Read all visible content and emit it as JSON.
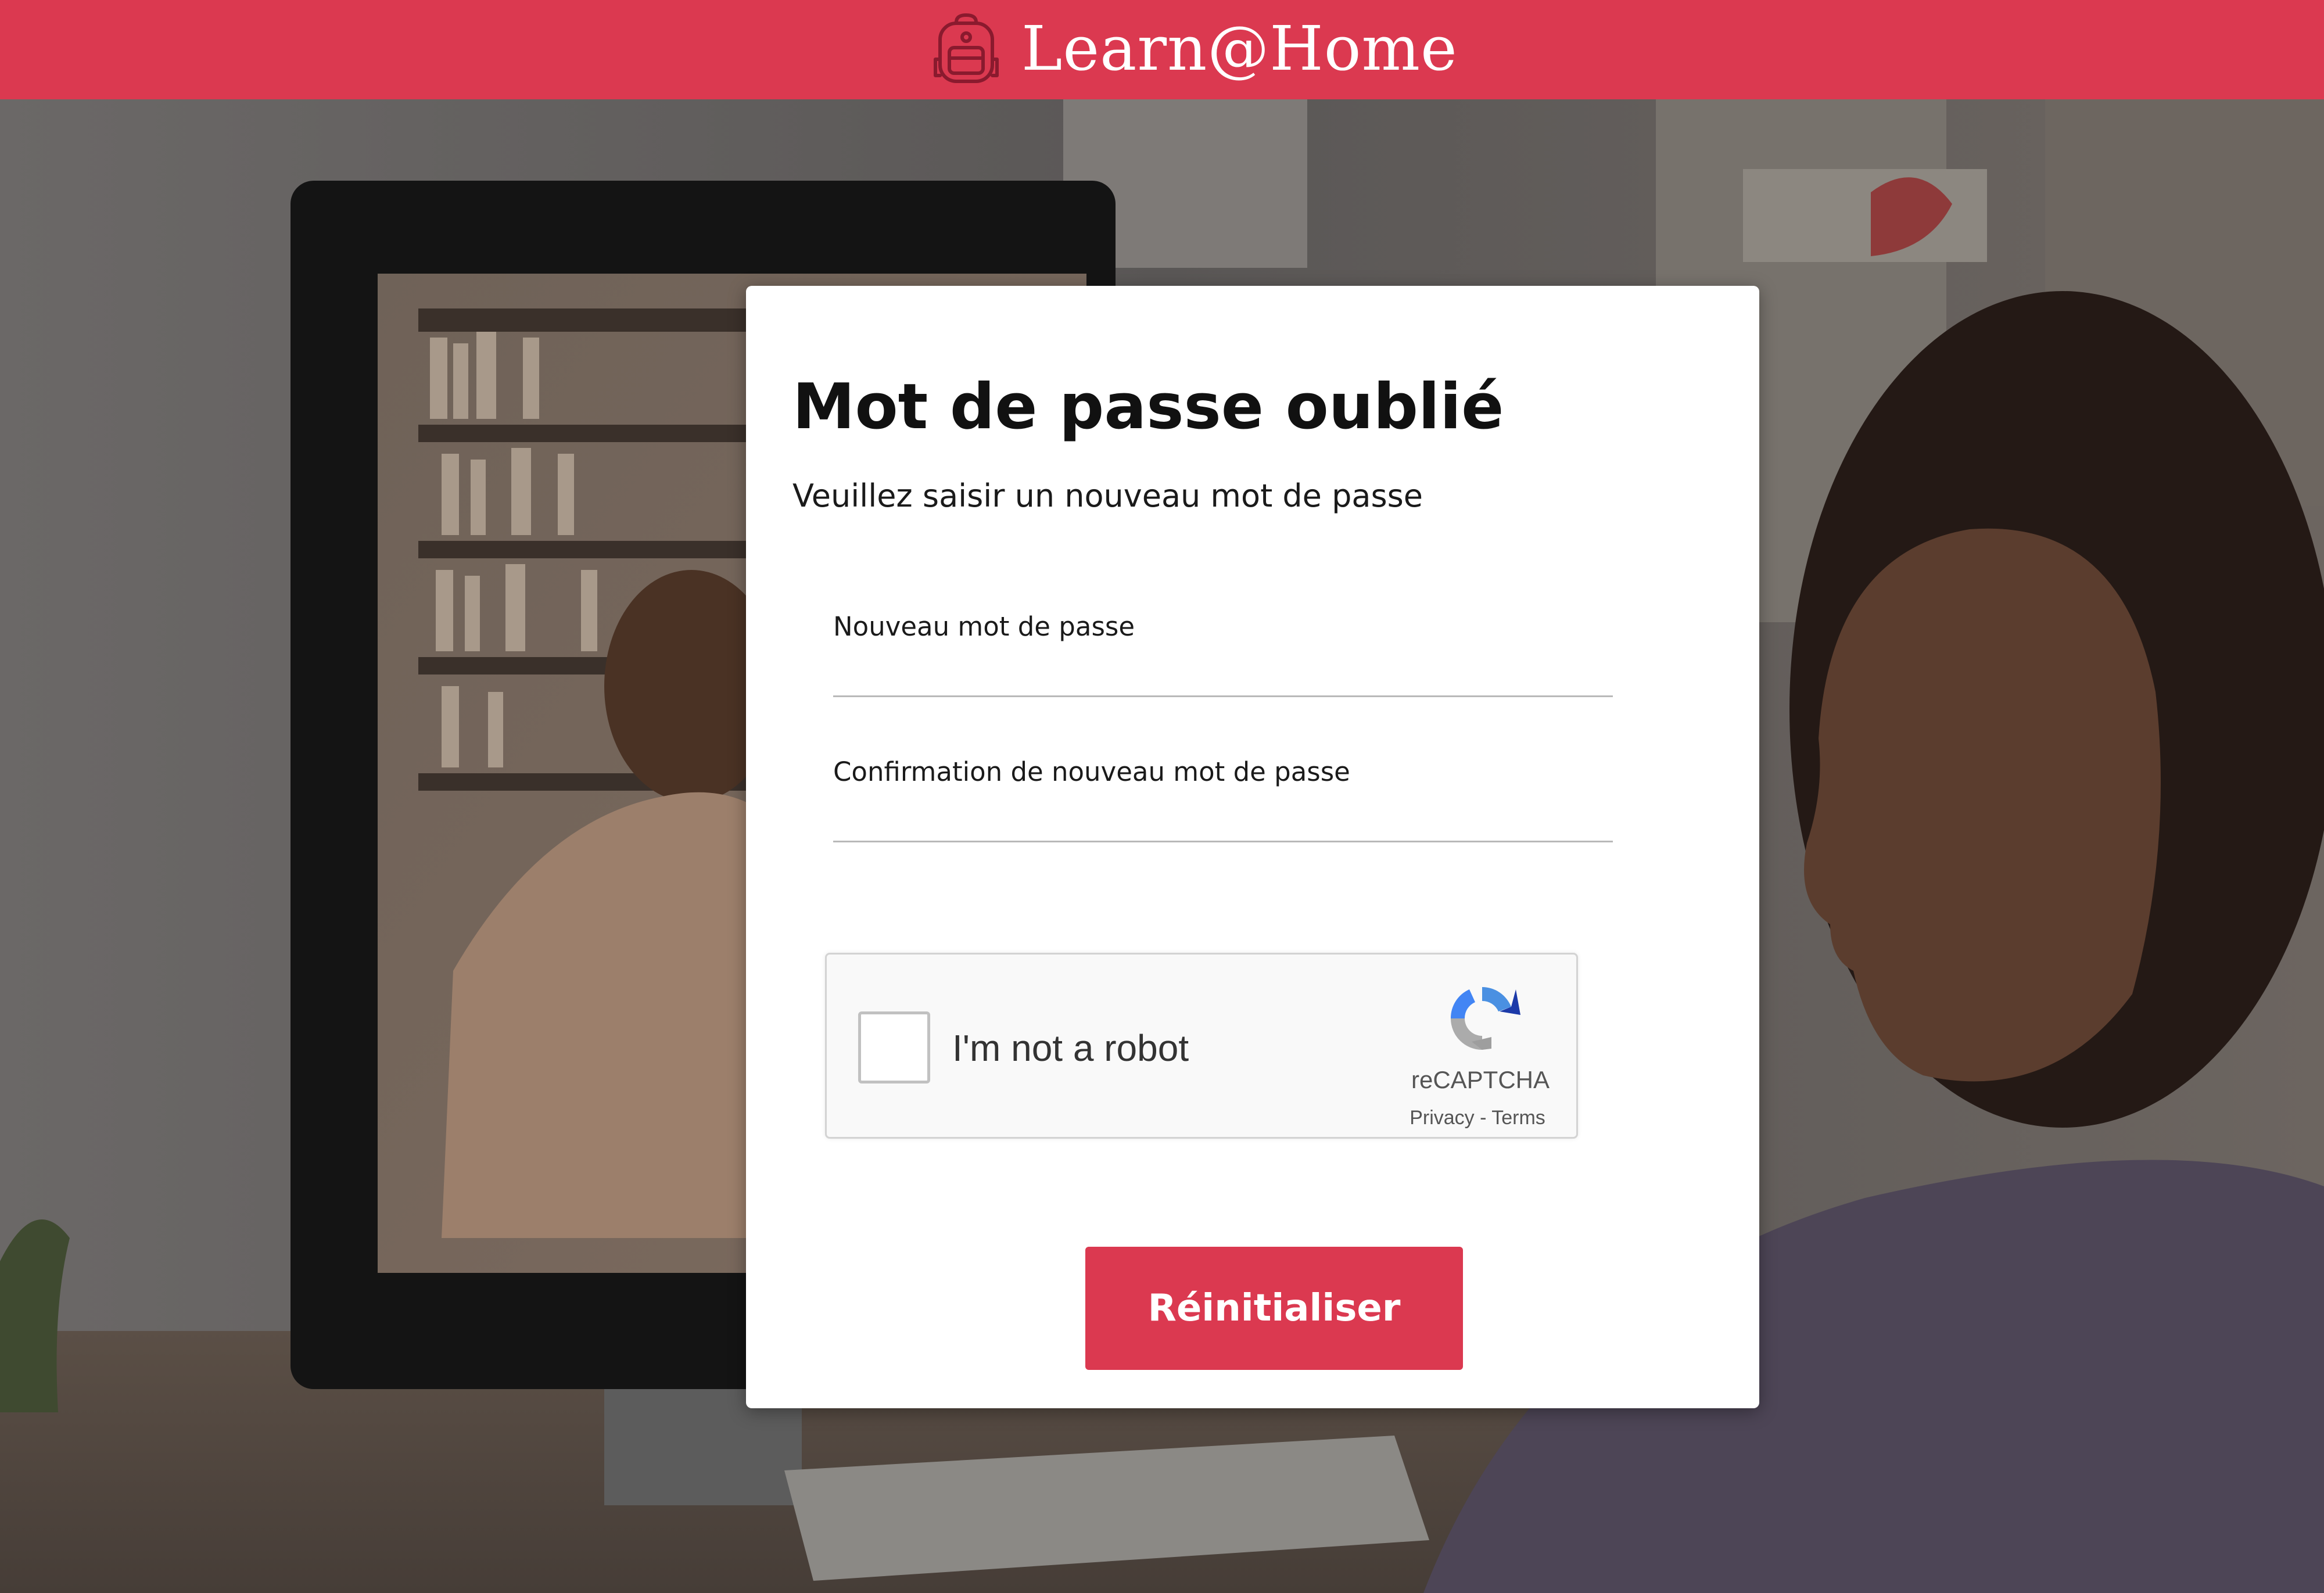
{
  "header": {
    "brand_name": "Learn@Home",
    "brand_icon": "backpack-icon",
    "bar_color": "#db3950"
  },
  "form": {
    "title": "Mot de passe oublié",
    "subtitle": "Veuillez saisir un nouveau mot de passe",
    "new_password": {
      "label": "Nouveau mot de passe",
      "value": ""
    },
    "confirm_password": {
      "label": "Confirmation de nouveau mot de passe",
      "value": ""
    },
    "submit_label": "Réinitialiser",
    "accent_color": "#db3950"
  },
  "captcha": {
    "checkbox_label": "I'm not a robot",
    "checked": false,
    "brand": "reCAPTCHA",
    "links": "Privacy - Terms",
    "logo_icon": "recaptcha-logo-icon"
  },
  "background": {
    "description_icon": "background-photo"
  }
}
